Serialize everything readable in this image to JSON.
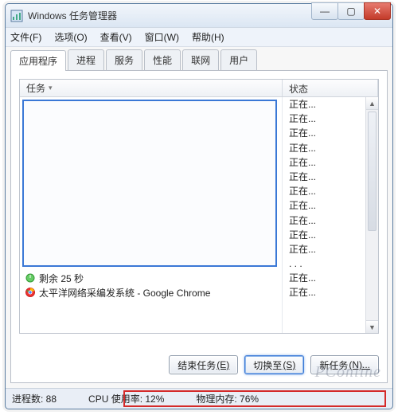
{
  "titlebar": {
    "icon": "task-manager-icon",
    "title": "Windows 任务管理器",
    "btn_min": "—",
    "btn_max": "▢",
    "btn_close": "✕"
  },
  "menubar": {
    "file": "文件(F)",
    "options": "选项(O)",
    "view": "查看(V)",
    "window": "窗口(W)",
    "help": "帮助(H)"
  },
  "tabs": {
    "applications": "应用程序",
    "processes": "进程",
    "services": "服务",
    "performance": "性能",
    "networking": "联网",
    "users": "用户"
  },
  "listview": {
    "col_task": "任务",
    "col_status": "状态",
    "status_label": "正在...",
    "ellipsis": ". . .",
    "rows": {
      "timer": {
        "label": "剩余 25 秒"
      },
      "chrome": {
        "label": "太平洋网络采编发系统 - Google Chrome"
      }
    }
  },
  "buttons": {
    "end_task": "结束任务",
    "end_task_key": "(E)",
    "switch_to": "切换至",
    "switch_to_key": "(S)",
    "new_task": "新任务",
    "new_task_key": "(N)..."
  },
  "statusbar": {
    "processes": "进程数: 88",
    "cpu": "CPU 使用率: 12%",
    "memory": "物理内存: 76%"
  },
  "watermark": "PConline"
}
